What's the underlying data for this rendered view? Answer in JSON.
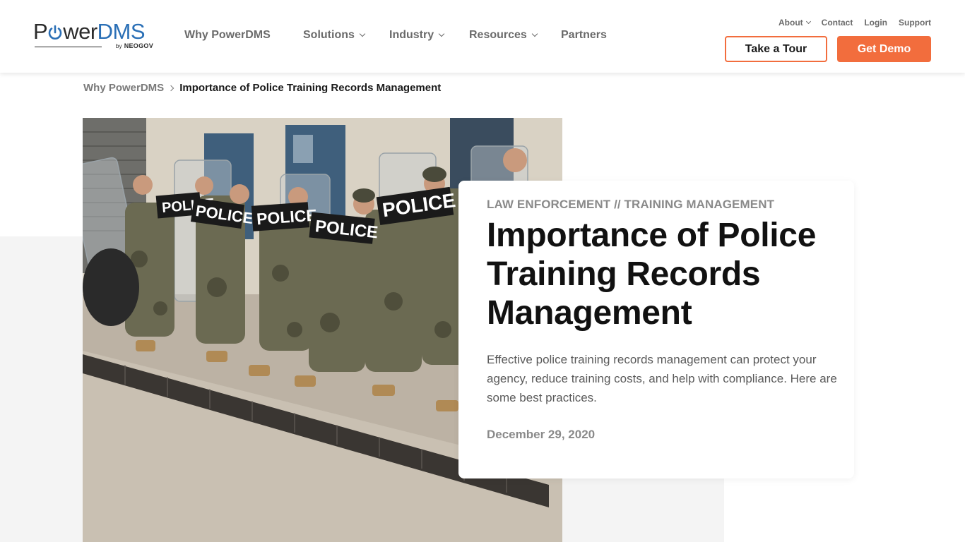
{
  "brand": {
    "logo_text_power": "Power",
    "logo_text_dms": "DMS",
    "logo_by": "by",
    "logo_neogov": "NEOGOV",
    "accent_color": "#f26d3d",
    "logo_blue": "#2a6fb6"
  },
  "main_nav": {
    "why": "Why PowerDMS",
    "solutions": "Solutions",
    "industry": "Industry",
    "resources": "Resources",
    "partners": "Partners"
  },
  "util_nav": {
    "about": "About",
    "contact": "Contact",
    "login": "Login",
    "support": "Support"
  },
  "cta": {
    "tour": "Take a Tour",
    "demo": "Get Demo"
  },
  "breadcrumb": {
    "parent": "Why PowerDMS",
    "current": "Importance of Police Training Records Management"
  },
  "article": {
    "categories": "LAW ENFORCEMENT // TRAINING MANAGEMENT",
    "title": "Importance of Police Training Records Management",
    "description": "Effective police training records management can protect your agency, reduce training costs, and help with compliance. Here are some best practices.",
    "date": "December 29, 2020"
  },
  "hero_image": {
    "shield_text": "POLICE"
  }
}
